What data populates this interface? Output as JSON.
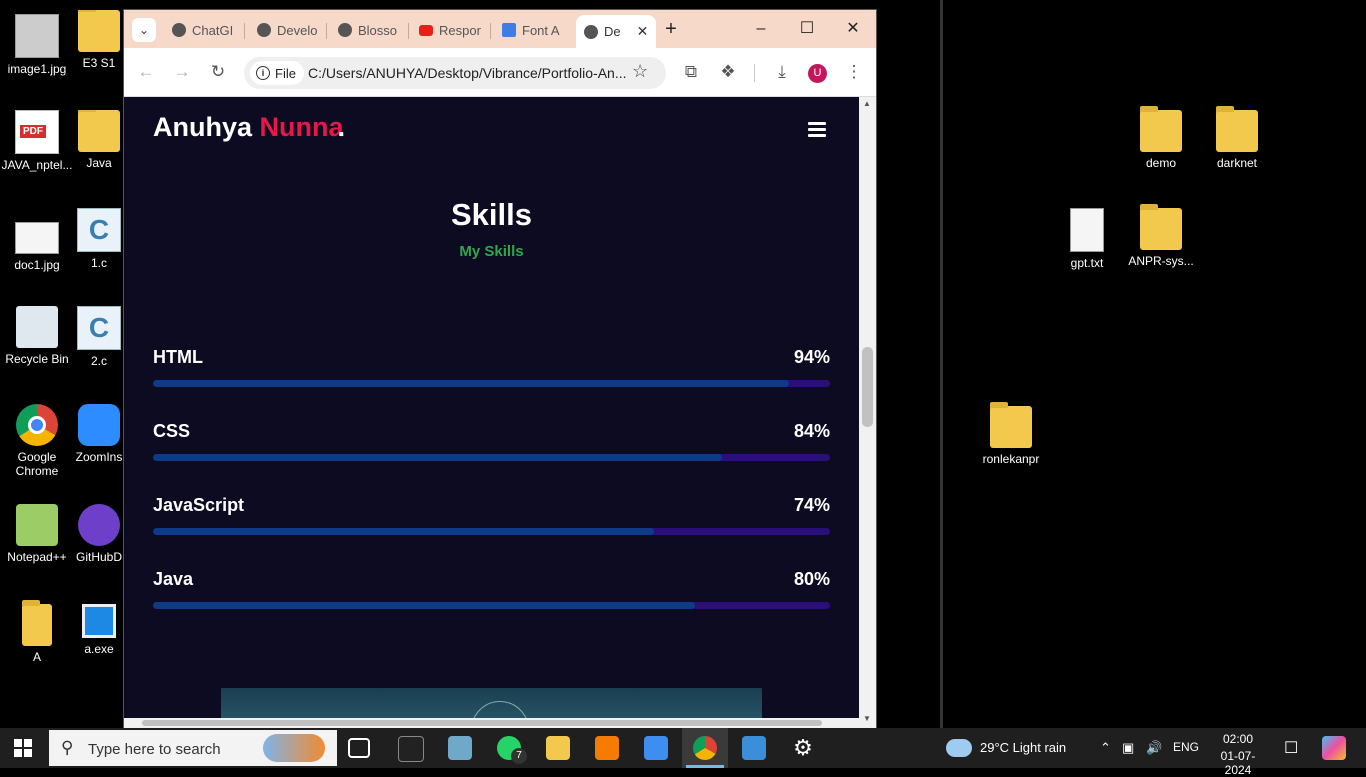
{
  "desktop": {
    "icons": [
      {
        "label": "image1.jpg"
      },
      {
        "label": "E3 S1"
      },
      {
        "label": "JAVA_nptel..."
      },
      {
        "label": "Java"
      },
      {
        "label": "doc1.jpg"
      },
      {
        "label": "1.c"
      },
      {
        "label": "Recycle Bin"
      },
      {
        "label": "2.c"
      },
      {
        "label": "Google Chrome"
      },
      {
        "label": "ZoomIns"
      },
      {
        "label": "Notepad++"
      },
      {
        "label": "GitHubD"
      },
      {
        "label": "A"
      },
      {
        "label": "a.exe"
      },
      {
        "label": "demo"
      },
      {
        "label": "darknet"
      },
      {
        "label": "gpt.txt"
      },
      {
        "label": "ANPR-sys..."
      },
      {
        "label": "ronlekanpr"
      }
    ]
  },
  "browser": {
    "tabs": [
      {
        "label": "ChatGI"
      },
      {
        "label": "Develo"
      },
      {
        "label": "Blosso"
      },
      {
        "label": "Respor"
      },
      {
        "label": "Font A"
      },
      {
        "label": "De"
      }
    ],
    "url_chip": "File",
    "url": "C:/Users/ANUHYA/Desktop/Vibrance/Portfolio-An...",
    "avatar_letter": "U"
  },
  "site": {
    "logo_first": "Anuhya",
    "logo_second": "Nunna",
    "logo_dot": ".",
    "section_title": "Skills",
    "section_subtitle": "My Skills",
    "skills": [
      {
        "name": "HTML",
        "percent_label": "94%",
        "level": 0.94
      },
      {
        "name": "CSS",
        "percent_label": "84%",
        "level": 0.84
      },
      {
        "name": "JavaScript",
        "percent_label": "74%",
        "level": 0.74
      },
      {
        "name": "Java",
        "percent_label": "80%",
        "level": 0.8
      }
    ]
  },
  "taskbar": {
    "search_placeholder": "Type here to search",
    "whatsapp_badge": "7",
    "weather": "29°C  Light rain",
    "language": "ENG",
    "time": "02:00",
    "date": "01-07-2024"
  },
  "colors": {
    "accent": "#e8174a",
    "subtitle": "#2ea84a",
    "bar_fill": "#0d3b86",
    "bar_track": "#2a0f7a",
    "page_bg": "#0d0b22"
  }
}
